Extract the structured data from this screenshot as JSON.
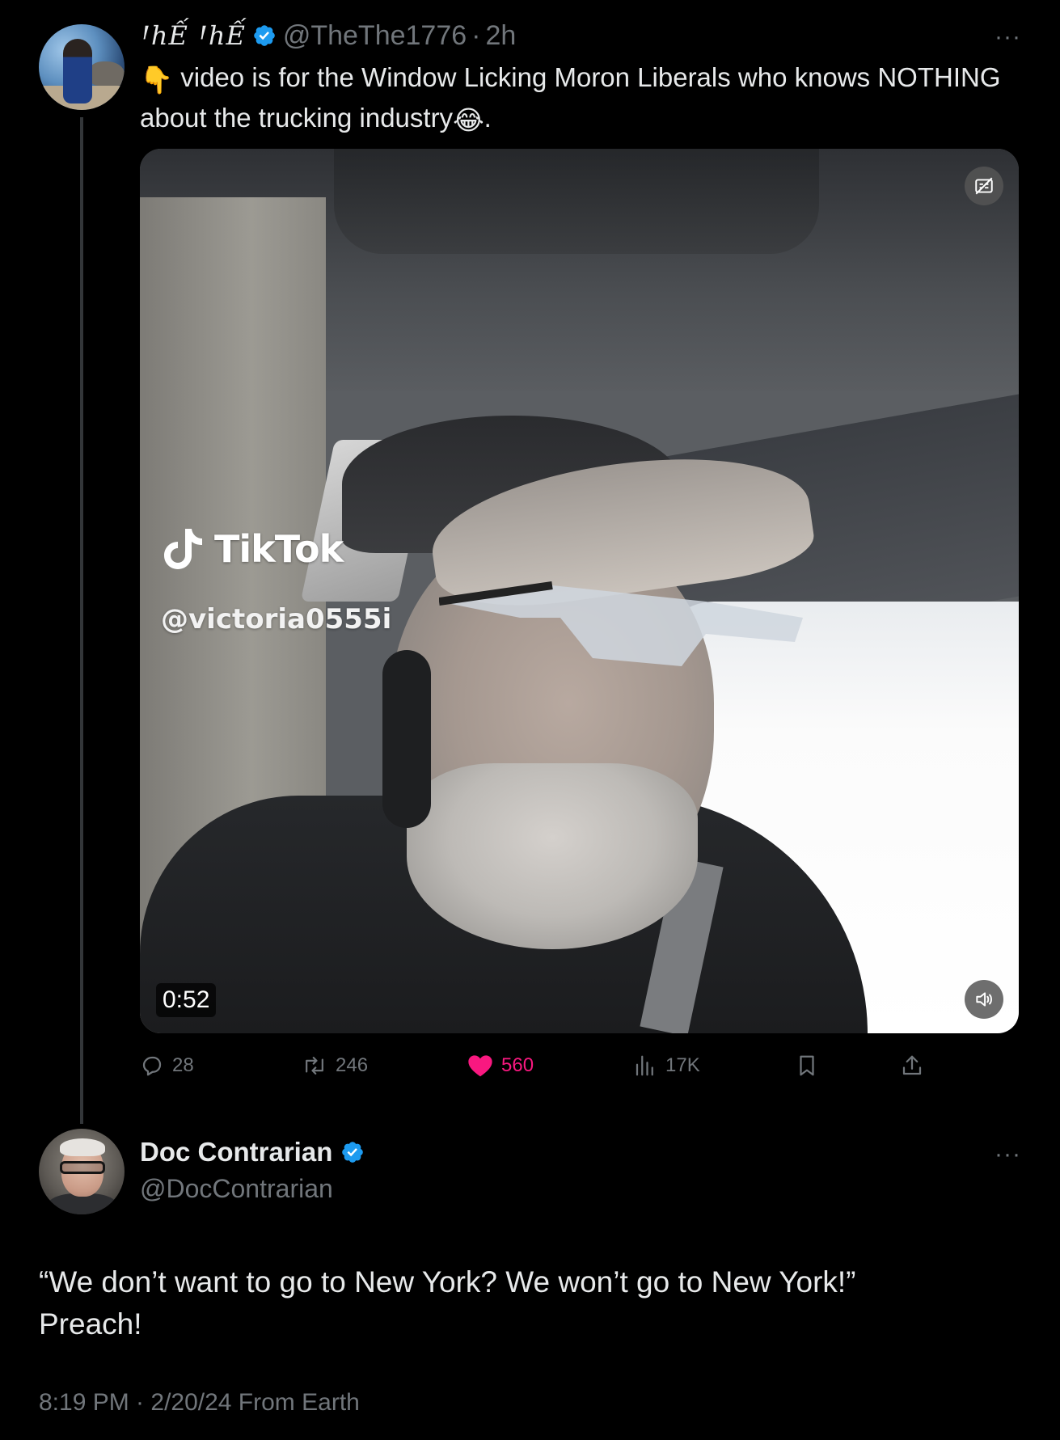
{
  "colors": {
    "background": "#000000",
    "text_primary": "#e7e9ea",
    "text_muted": "#71767b",
    "verified_blue": "#1d9bf0",
    "like_pink": "#f91880"
  },
  "quoted_tweet": {
    "display_name": "ꞋhẾ ꞋhẾ",
    "handle": "@TheThe1776",
    "separator": "·",
    "time": "2h",
    "more_icon": "more-horizontal-icon",
    "text_emoji_lead": "👇",
    "text_line": "video is for the Window Licking Moron Liberals who knows NOTHING about the trucking industry",
    "text_emoji_trail": "😂",
    "text_end": ".",
    "video": {
      "watermark_brand": "TikTok",
      "watermark_handle": "@victoria0555i",
      "duration": "0:52",
      "captions_icon": "captions-off-icon",
      "volume_icon": "volume-icon"
    },
    "actions": {
      "replies": "28",
      "reposts": "246",
      "likes": "560",
      "views": "17K",
      "reply_icon": "reply-icon",
      "repost_icon": "repost-icon",
      "like_icon": "heart-filled-icon",
      "views_icon": "views-chart-icon",
      "bookmark_icon": "bookmark-icon",
      "share_icon": "share-icon"
    }
  },
  "reply_tweet": {
    "display_name": "Doc Contrarian",
    "handle": "@DocContrarian",
    "more_icon": "more-horizontal-icon",
    "text_line1": "“We don’t want to go to New York? We won’t go to New York!”",
    "text_line2": "Preach!",
    "timestamp": "8:19 PM · 2/20/24 From Earth"
  }
}
